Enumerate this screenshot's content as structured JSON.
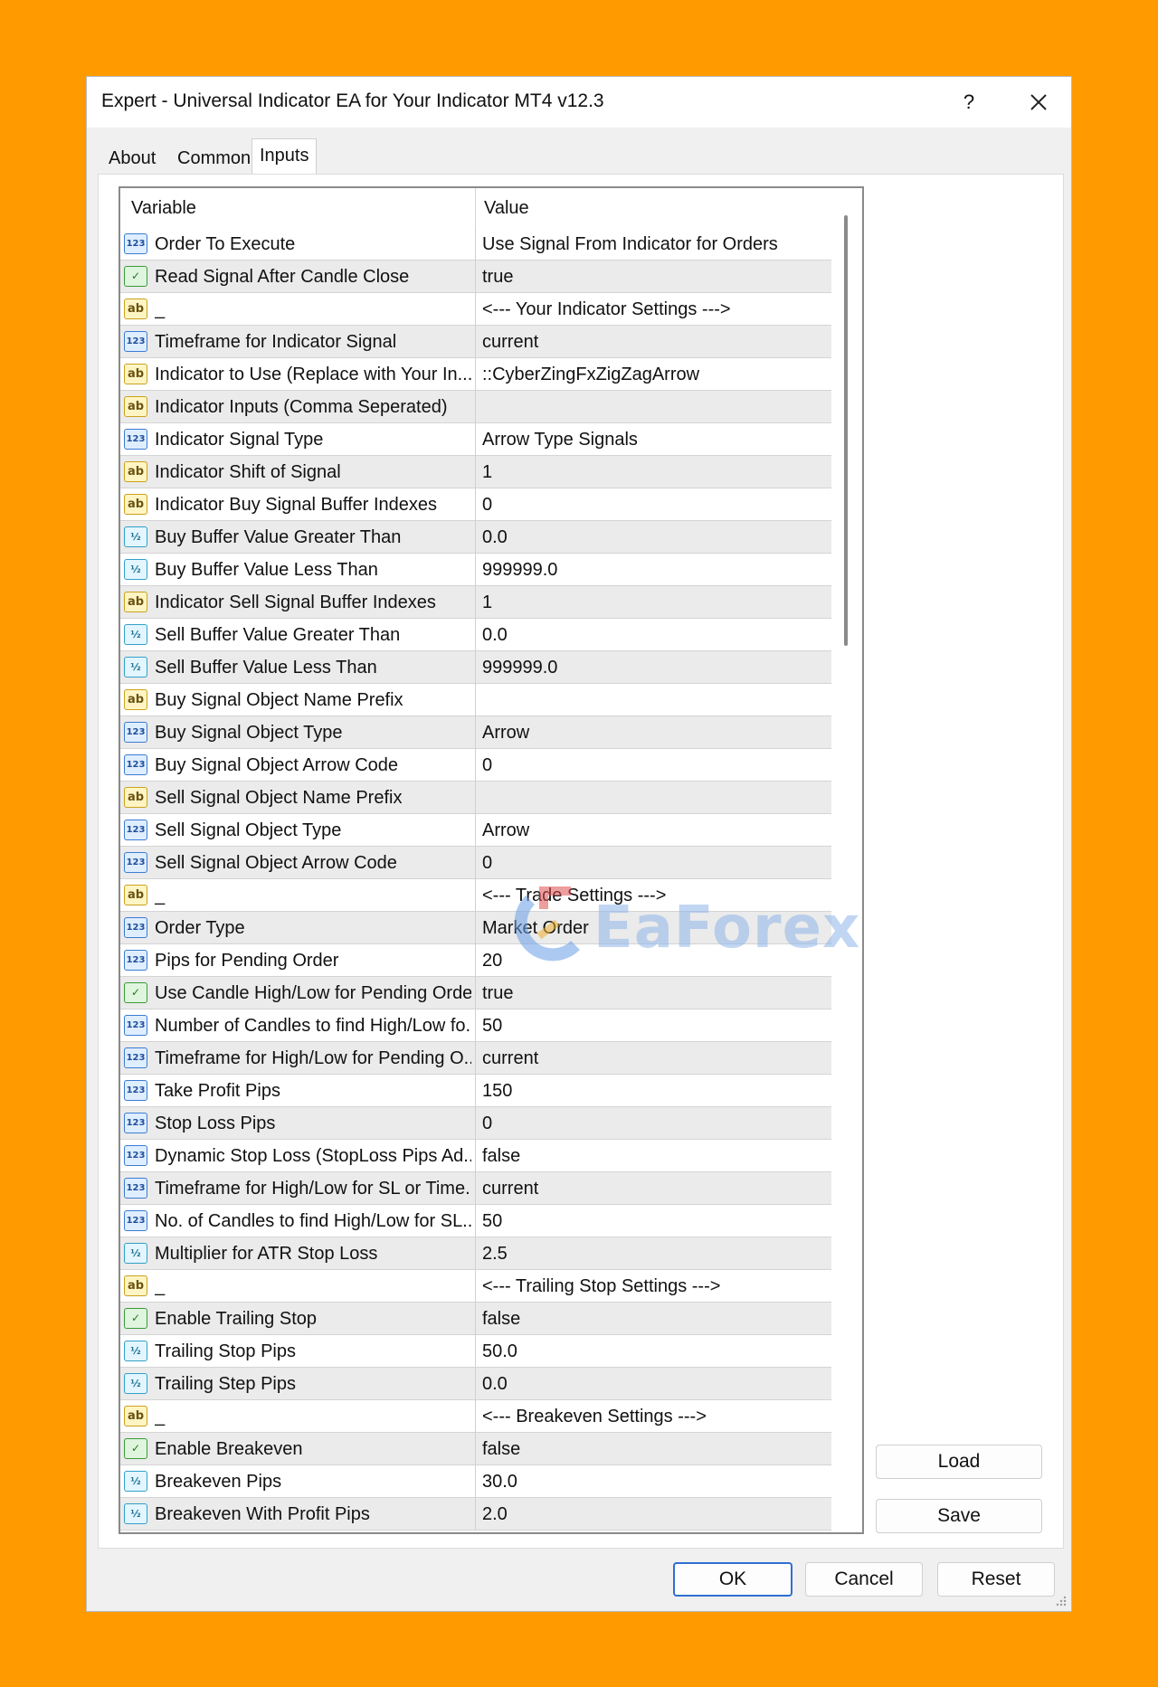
{
  "window": {
    "title": "Expert - Universal Indicator EA for Your Indicator MT4 v12.3",
    "help_label": "?"
  },
  "tabs": [
    {
      "label": "About"
    },
    {
      "label": "Common"
    },
    {
      "label": "Inputs"
    }
  ],
  "active_tab": "Inputs",
  "grid": {
    "headers": {
      "variable": "Variable",
      "value": "Value"
    },
    "rows": [
      {
        "type": "int",
        "variable": "Order To Execute",
        "value": "Use Signal From Indicator for Orders"
      },
      {
        "type": "bool",
        "variable": "Read Signal After Candle Close",
        "value": "true"
      },
      {
        "type": "string",
        "variable": "_",
        "value": "<--- Your Indicator Settings --->"
      },
      {
        "type": "int",
        "variable": "Timeframe for Indicator Signal",
        "value": "current"
      },
      {
        "type": "string",
        "variable": "Indicator to Use (Replace with Your In...",
        "value": "::CyberZingFxZigZagArrow"
      },
      {
        "type": "string",
        "variable": "Indicator Inputs (Comma Seperated)",
        "value": ""
      },
      {
        "type": "int",
        "variable": "Indicator Signal Type",
        "value": "Arrow Type Signals"
      },
      {
        "type": "string",
        "variable": "Indicator Shift of Signal",
        "value": "1"
      },
      {
        "type": "string",
        "variable": "Indicator Buy Signal Buffer Indexes",
        "value": "0"
      },
      {
        "type": "double",
        "variable": "Buy Buffer Value Greater Than",
        "value": "0.0"
      },
      {
        "type": "double",
        "variable": "Buy Buffer Value Less Than",
        "value": "999999.0"
      },
      {
        "type": "string",
        "variable": "Indicator Sell Signal Buffer Indexes",
        "value": "1"
      },
      {
        "type": "double",
        "variable": "Sell Buffer Value Greater Than",
        "value": "0.0"
      },
      {
        "type": "double",
        "variable": "Sell Buffer Value Less Than",
        "value": "999999.0"
      },
      {
        "type": "string",
        "variable": "Buy Signal Object Name Prefix",
        "value": ""
      },
      {
        "type": "int",
        "variable": "Buy Signal Object Type",
        "value": "Arrow"
      },
      {
        "type": "int",
        "variable": "Buy Signal Object Arrow Code",
        "value": "0"
      },
      {
        "type": "string",
        "variable": "Sell Signal Object Name Prefix",
        "value": ""
      },
      {
        "type": "int",
        "variable": "Sell Signal Object Type",
        "value": "Arrow"
      },
      {
        "type": "int",
        "variable": "Sell Signal Object Arrow Code",
        "value": "0"
      },
      {
        "type": "string",
        "variable": "_",
        "value": "<--- Trade Settings --->"
      },
      {
        "type": "int",
        "variable": "Order Type",
        "value": "Market Order"
      },
      {
        "type": "int",
        "variable": "Pips for Pending Order",
        "value": "20"
      },
      {
        "type": "bool",
        "variable": "Use Candle High/Low for Pending Order",
        "value": "true"
      },
      {
        "type": "int",
        "variable": "Number of Candles to find High/Low fo...",
        "value": "50"
      },
      {
        "type": "int",
        "variable": "Timeframe for High/Low for Pending O...",
        "value": "current"
      },
      {
        "type": "int",
        "variable": "Take Profit Pips",
        "value": "150"
      },
      {
        "type": "int",
        "variable": "Stop Loss Pips",
        "value": "0"
      },
      {
        "type": "int",
        "variable": "Dynamic Stop Loss (StopLoss Pips Ad...",
        "value": "false"
      },
      {
        "type": "int",
        "variable": "Timeframe for High/Low for SL or Time...",
        "value": "current"
      },
      {
        "type": "int",
        "variable": "No. of Candles to find High/Low for SL...",
        "value": "50"
      },
      {
        "type": "double",
        "variable": "Multiplier for ATR Stop Loss",
        "value": "2.5"
      },
      {
        "type": "string",
        "variable": "_",
        "value": "<--- Trailing Stop Settings --->"
      },
      {
        "type": "bool",
        "variable": "Enable Trailing Stop",
        "value": "false"
      },
      {
        "type": "double",
        "variable": "Trailing Stop Pips",
        "value": "50.0"
      },
      {
        "type": "double",
        "variable": "Trailing Step Pips",
        "value": "0.0"
      },
      {
        "type": "string",
        "variable": "_",
        "value": "<--- Breakeven Settings --->"
      },
      {
        "type": "bool",
        "variable": "Enable Breakeven",
        "value": "false"
      },
      {
        "type": "double",
        "variable": "Breakeven Pips",
        "value": "30.0"
      },
      {
        "type": "double",
        "variable": "Breakeven With Profit Pips",
        "value": "2.0"
      }
    ]
  },
  "icons": {
    "int": {
      "name": "integer-type-icon",
      "glyph": "123"
    },
    "string": {
      "name": "string-type-icon",
      "glyph": "ab"
    },
    "bool": {
      "name": "boolean-type-icon",
      "glyph": "✓"
    },
    "double": {
      "name": "double-type-icon",
      "glyph": "½"
    }
  },
  "buttons": {
    "load": "Load",
    "save": "Save",
    "ok": "OK",
    "cancel": "Cancel",
    "reset": "Reset"
  },
  "watermark": {
    "text": "EaForex"
  },
  "colors": {
    "background": "#ff9a00",
    "accent": "#2f6fd0"
  }
}
